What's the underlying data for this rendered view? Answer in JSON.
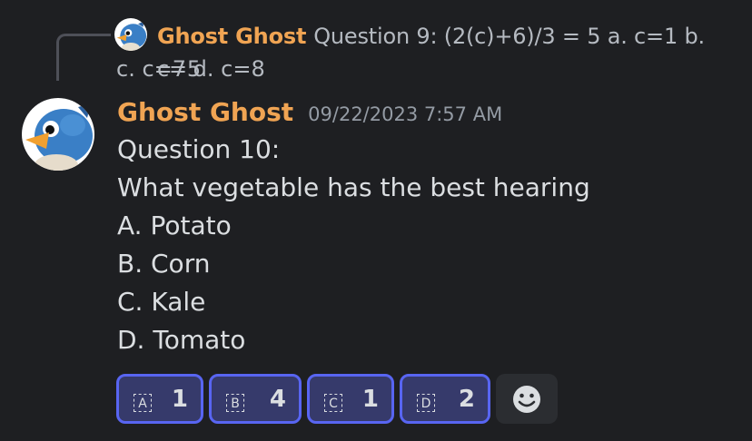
{
  "reply": {
    "author": "Ghost Ghost",
    "text_line1": "Question 9: (2(c)+6)/3 = 5  a. c=1 b. c=5",
    "text_line2": "c. c=7 d. c=8"
  },
  "message": {
    "author": "Ghost Ghost",
    "timestamp": "09/22/2023 7:57 AM",
    "lines": [
      "Question 10:",
      "What vegetable has the best hearing",
      "A. Potato",
      "B. Corn",
      "C. Kale",
      "D. Tomato"
    ]
  },
  "reactions": [
    {
      "emoji": "A",
      "count": "1"
    },
    {
      "emoji": "B",
      "count": "4"
    },
    {
      "emoji": "C",
      "count": "1"
    },
    {
      "emoji": "D",
      "count": "2"
    }
  ],
  "add_reaction_icon": "smiley-add-reaction-icon",
  "colors": {
    "background": "#1e1f22",
    "author": "#f0a453",
    "text": "#dbdee1",
    "muted": "#949ba4",
    "reaction_border": "#5865f2",
    "reaction_bg": "#363a6b"
  }
}
